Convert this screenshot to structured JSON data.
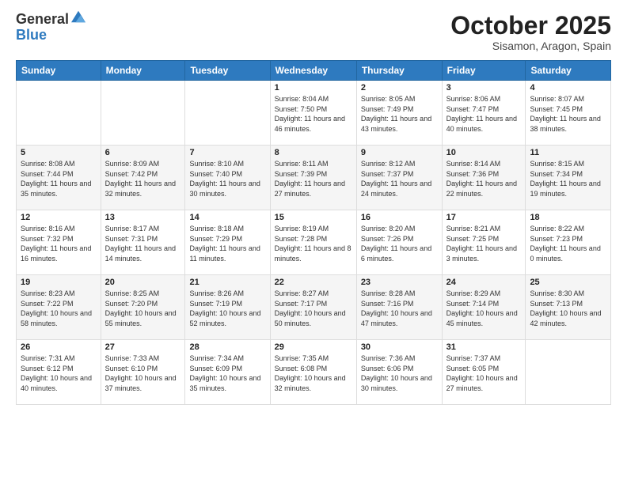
{
  "logo": {
    "general": "General",
    "blue": "Blue"
  },
  "header": {
    "month": "October 2025",
    "location": "Sisamon, Aragon, Spain"
  },
  "days_of_week": [
    "Sunday",
    "Monday",
    "Tuesday",
    "Wednesday",
    "Thursday",
    "Friday",
    "Saturday"
  ],
  "weeks": [
    [
      {
        "day": "",
        "content": ""
      },
      {
        "day": "",
        "content": ""
      },
      {
        "day": "",
        "content": ""
      },
      {
        "day": "1",
        "content": "Sunrise: 8:04 AM\nSunset: 7:50 PM\nDaylight: 11 hours\nand 46 minutes."
      },
      {
        "day": "2",
        "content": "Sunrise: 8:05 AM\nSunset: 7:49 PM\nDaylight: 11 hours\nand 43 minutes."
      },
      {
        "day": "3",
        "content": "Sunrise: 8:06 AM\nSunset: 7:47 PM\nDaylight: 11 hours\nand 40 minutes."
      },
      {
        "day": "4",
        "content": "Sunrise: 8:07 AM\nSunset: 7:45 PM\nDaylight: 11 hours\nand 38 minutes."
      }
    ],
    [
      {
        "day": "5",
        "content": "Sunrise: 8:08 AM\nSunset: 7:44 PM\nDaylight: 11 hours\nand 35 minutes."
      },
      {
        "day": "6",
        "content": "Sunrise: 8:09 AM\nSunset: 7:42 PM\nDaylight: 11 hours\nand 32 minutes."
      },
      {
        "day": "7",
        "content": "Sunrise: 8:10 AM\nSunset: 7:40 PM\nDaylight: 11 hours\nand 30 minutes."
      },
      {
        "day": "8",
        "content": "Sunrise: 8:11 AM\nSunset: 7:39 PM\nDaylight: 11 hours\nand 27 minutes."
      },
      {
        "day": "9",
        "content": "Sunrise: 8:12 AM\nSunset: 7:37 PM\nDaylight: 11 hours\nand 24 minutes."
      },
      {
        "day": "10",
        "content": "Sunrise: 8:14 AM\nSunset: 7:36 PM\nDaylight: 11 hours\nand 22 minutes."
      },
      {
        "day": "11",
        "content": "Sunrise: 8:15 AM\nSunset: 7:34 PM\nDaylight: 11 hours\nand 19 minutes."
      }
    ],
    [
      {
        "day": "12",
        "content": "Sunrise: 8:16 AM\nSunset: 7:32 PM\nDaylight: 11 hours\nand 16 minutes."
      },
      {
        "day": "13",
        "content": "Sunrise: 8:17 AM\nSunset: 7:31 PM\nDaylight: 11 hours\nand 14 minutes."
      },
      {
        "day": "14",
        "content": "Sunrise: 8:18 AM\nSunset: 7:29 PM\nDaylight: 11 hours\nand 11 minutes."
      },
      {
        "day": "15",
        "content": "Sunrise: 8:19 AM\nSunset: 7:28 PM\nDaylight: 11 hours\nand 8 minutes."
      },
      {
        "day": "16",
        "content": "Sunrise: 8:20 AM\nSunset: 7:26 PM\nDaylight: 11 hours\nand 6 minutes."
      },
      {
        "day": "17",
        "content": "Sunrise: 8:21 AM\nSunset: 7:25 PM\nDaylight: 11 hours\nand 3 minutes."
      },
      {
        "day": "18",
        "content": "Sunrise: 8:22 AM\nSunset: 7:23 PM\nDaylight: 11 hours\nand 0 minutes."
      }
    ],
    [
      {
        "day": "19",
        "content": "Sunrise: 8:23 AM\nSunset: 7:22 PM\nDaylight: 10 hours\nand 58 minutes."
      },
      {
        "day": "20",
        "content": "Sunrise: 8:25 AM\nSunset: 7:20 PM\nDaylight: 10 hours\nand 55 minutes."
      },
      {
        "day": "21",
        "content": "Sunrise: 8:26 AM\nSunset: 7:19 PM\nDaylight: 10 hours\nand 52 minutes."
      },
      {
        "day": "22",
        "content": "Sunrise: 8:27 AM\nSunset: 7:17 PM\nDaylight: 10 hours\nand 50 minutes."
      },
      {
        "day": "23",
        "content": "Sunrise: 8:28 AM\nSunset: 7:16 PM\nDaylight: 10 hours\nand 47 minutes."
      },
      {
        "day": "24",
        "content": "Sunrise: 8:29 AM\nSunset: 7:14 PM\nDaylight: 10 hours\nand 45 minutes."
      },
      {
        "day": "25",
        "content": "Sunrise: 8:30 AM\nSunset: 7:13 PM\nDaylight: 10 hours\nand 42 minutes."
      }
    ],
    [
      {
        "day": "26",
        "content": "Sunrise: 7:31 AM\nSunset: 6:12 PM\nDaylight: 10 hours\nand 40 minutes."
      },
      {
        "day": "27",
        "content": "Sunrise: 7:33 AM\nSunset: 6:10 PM\nDaylight: 10 hours\nand 37 minutes."
      },
      {
        "day": "28",
        "content": "Sunrise: 7:34 AM\nSunset: 6:09 PM\nDaylight: 10 hours\nand 35 minutes."
      },
      {
        "day": "29",
        "content": "Sunrise: 7:35 AM\nSunset: 6:08 PM\nDaylight: 10 hours\nand 32 minutes."
      },
      {
        "day": "30",
        "content": "Sunrise: 7:36 AM\nSunset: 6:06 PM\nDaylight: 10 hours\nand 30 minutes."
      },
      {
        "day": "31",
        "content": "Sunrise: 7:37 AM\nSunset: 6:05 PM\nDaylight: 10 hours\nand 27 minutes."
      },
      {
        "day": "",
        "content": ""
      }
    ]
  ]
}
